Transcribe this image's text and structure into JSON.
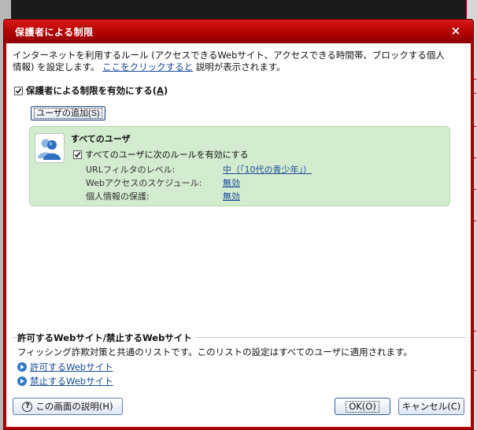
{
  "dialog": {
    "title": "保護者による制限",
    "close": "×"
  },
  "description": {
    "line1": "インターネットを利用するルール (アクセスできるWebサイト、アクセスできる時間帯、ブロックする個人",
    "line2_a": "情報) を設定します。",
    "line2_link": "ここをクリックすると",
    "line2_b": "説明が表示されます。"
  },
  "enable": {
    "label": "保護者による制限を有効にする(",
    "key": "A",
    "label_end": ")",
    "checked": true
  },
  "add_user": {
    "label": "ユーザの追加(S)"
  },
  "user": {
    "name": "すべてのユーザ",
    "rule_label": "すべてのユーザに次のルールを有効にする",
    "rule_checked": true,
    "settings": [
      {
        "label": "URLフィルタのレベル:",
        "value": "中（「10代の青少年」）"
      },
      {
        "label": "Webアクセスのスケジュール:",
        "value": "無効"
      },
      {
        "label": "個人情報の保護:",
        "value": "無効"
      }
    ]
  },
  "sites": {
    "heading": "許可するWebサイト/禁止するWebサイト",
    "description": "フィッシング詐欺対策と共通のリストです。このリストの設定はすべてのユーザに適用されます。",
    "allow_link": "許可するWebサイト",
    "block_link": "禁止するWebサイト"
  },
  "buttons": {
    "help_icon": "?",
    "help": "この画面の説明(H)",
    "ok": "OK(O)",
    "cancel": "キャンセル(C)"
  },
  "colors": {
    "titlebar": "#b30000",
    "panel": "#d3ebcf",
    "link": "#1a4a9a"
  }
}
